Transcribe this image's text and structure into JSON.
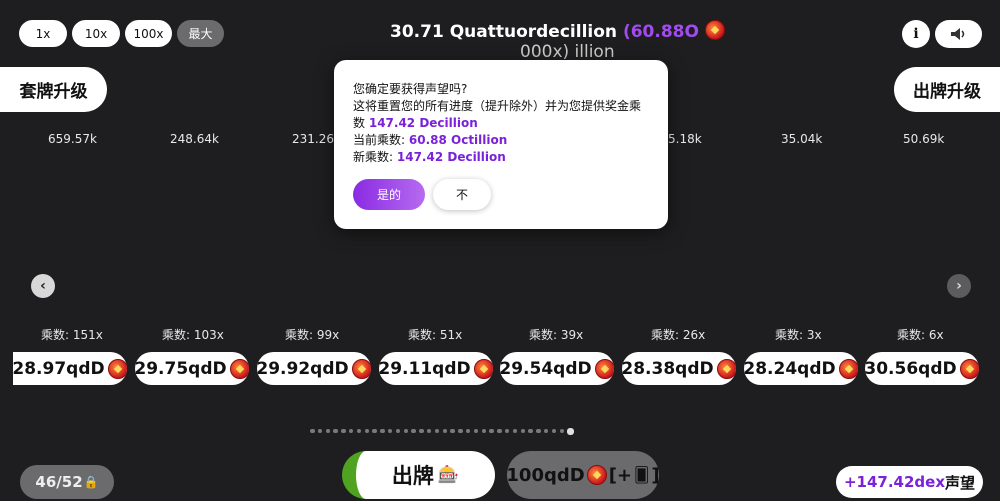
{
  "toolbar": {
    "multipliers": [
      "1x",
      "10x",
      "100x",
      "最大"
    ]
  },
  "header": {
    "title": "30.71 Quattuordecillion",
    "title_suffix": "(60.88O",
    "ghost_line": "000x) illion"
  },
  "buttons": {
    "info_label": "i",
    "sound_icon": "speaker-icon",
    "deck_upgrade": "套牌升级",
    "card_upgrade": "出牌升级"
  },
  "values": [
    "659.57k",
    "248.64k",
    "231.26k",
    "",
    "",
    "5.18k",
    "35.04k",
    "50.69k"
  ],
  "multiplier_labels": [
    "乘数: 151x",
    "乘数: 103x",
    "乘数: 99x",
    "乘数: 51x",
    "乘数: 39x",
    "乘数: 26x",
    "乘数: 3x",
    "乘数: 6x"
  ],
  "chips": [
    "28.97qdD",
    "29.75qdD",
    "29.92qdD",
    "29.11qdD",
    "29.54qdD",
    "28.38qdD",
    "28.24qdD",
    "30.56qdD"
  ],
  "pagination": {
    "total": 34,
    "active_index": 33
  },
  "footer": {
    "deck_count": "46/52",
    "play_label": "出牌",
    "play_icon": "slot-machine-icon",
    "cost": "100qdD",
    "cost_bracket": "[+",
    "cost_bracket_close": "]",
    "prestige_value": "+147.42dex",
    "prestige_label": "声望"
  },
  "modal": {
    "line1": "您确定要获得声望吗?",
    "line2": "这将重置您的所有进度（提升除外）并为您提供奖金乘数",
    "bonus": "147.42 Decillion",
    "current_label": "当前乘数:",
    "current_value": "60.88 Octillion",
    "new_label": "新乘数:",
    "new_value": "147.42 Decillion",
    "yes_label": "是的",
    "no_label": "不"
  },
  "colors": {
    "background": "#1e1e20",
    "accent_purple": "#7b22d9",
    "play_green": "#4fa320"
  }
}
